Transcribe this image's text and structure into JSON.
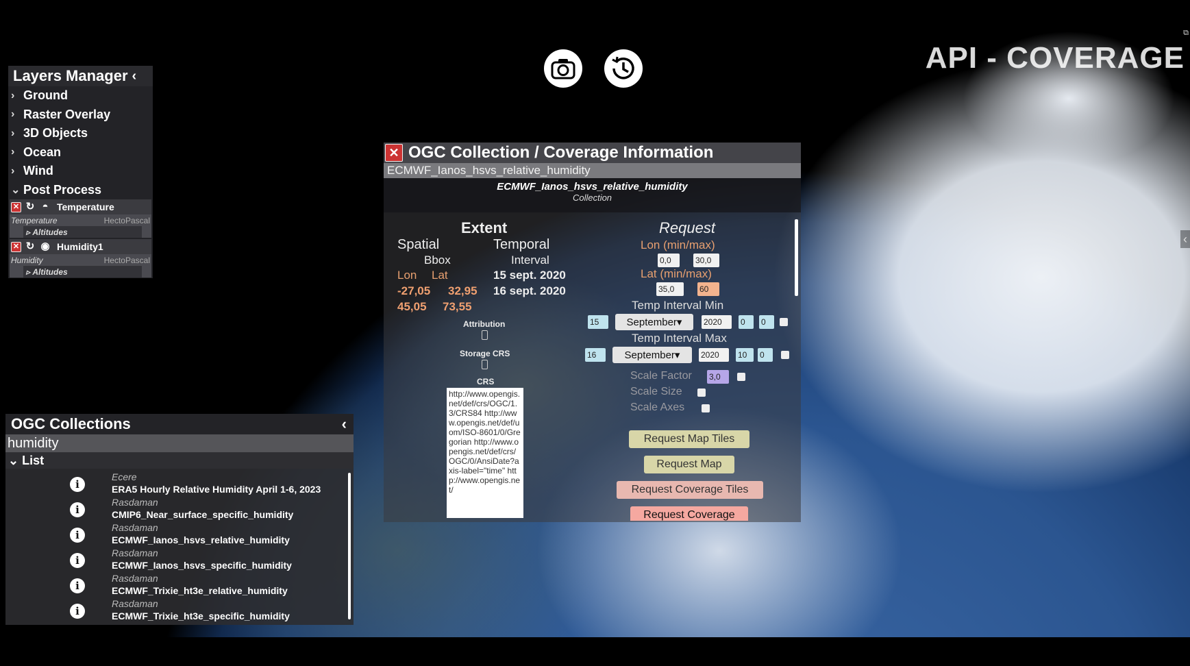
{
  "app": {
    "title": "API - COVERAGE"
  },
  "layers": {
    "title": "Layers Manager",
    "items": [
      "Ground",
      "Raster Overlay",
      "3D Objects",
      "Ocean",
      "Wind",
      "Post Process"
    ],
    "post_process": [
      {
        "name": "Temperature",
        "variable": "Temperature",
        "unit": "HectoPascal",
        "altitudes": "Altitudes"
      },
      {
        "name": "Humidity1",
        "variable": "Humidity",
        "unit": "HectoPascal",
        "altitudes": "Altitudes"
      }
    ]
  },
  "ogc": {
    "title": "OGC Collections",
    "search_value": "humidity",
    "list_label": "List",
    "collections": [
      {
        "provider": "Ecere",
        "name": "ERA5 Hourly Relative Humidity April 1-6, 2023"
      },
      {
        "provider": "Rasdaman",
        "name": "CMIP6_Near_surface_specific_humidity"
      },
      {
        "provider": "Rasdaman",
        "name": "ECMWF_Ianos_hsvs_relative_humidity"
      },
      {
        "provider": "Rasdaman",
        "name": "ECMWF_Ianos_hsvs_specific_humidity"
      },
      {
        "provider": "Rasdaman",
        "name": "ECMWF_Trixie_ht3e_relative_humidity"
      },
      {
        "provider": "Rasdaman",
        "name": "ECMWF_Trixie_ht3e_specific_humidity"
      }
    ]
  },
  "dialog": {
    "title": "OGC Collection / Coverage Information",
    "selected": "ECMWF_Ianos_hsvs_relative_humidity",
    "name": "ECMWF_Ianos_hsvs_relative_humidity",
    "kind": "Collection",
    "extent": {
      "title": "Extent",
      "spatial": "Spatial",
      "bbox": "Bbox",
      "lon": "Lon",
      "lat": "Lat",
      "lon1": "-27,05",
      "lat1": "32,95",
      "lon2": "45,05",
      "lat2": "73,55",
      "temporal": "Temporal",
      "interval": "Interval",
      "start": "15 sept. 2020",
      "end": "16 sept. 2020",
      "attribution": "Attribution",
      "storage_crs": "Storage CRS",
      "crs": "CRS",
      "crs_text": "http://www.opengis.net/def/crs/OGC/1.3/CRS84 http://www.opengis.net/def/uom/ISO-8601/0/Gregorian http://www.opengis.net/def/crs/OGC/0/AnsiDate?axis-label=\"time\" http://www.opengis.net/"
    },
    "request": {
      "title": "Request",
      "lon_label": "Lon (min/max)",
      "lon_min": "0,0",
      "lon_max": "30,0",
      "lat_label": "Lat (min/max)",
      "lat_min": "35,0",
      "lat_max": "60",
      "tmin_label": "Temp Interval Min",
      "tmin_day": "15",
      "tmin_month": "September",
      "tmin_year": "2020",
      "tmin_h": "0",
      "tmin_m": "0",
      "tmax_label": "Temp Interval Max",
      "tmax_day": "16",
      "tmax_month": "September",
      "tmax_year": "2020",
      "tmax_h": "10",
      "tmax_m": "0",
      "scale_factor_label": "Scale Factor",
      "scale_factor": "3,0",
      "scale_size_label": "Scale Size",
      "scale_axes_label": "Scale Axes",
      "btn_map_tiles": "Request Map Tiles",
      "btn_map": "Request Map",
      "btn_cov_tiles": "Request Coverage Tiles",
      "btn_cov": "Request Coverage"
    }
  }
}
